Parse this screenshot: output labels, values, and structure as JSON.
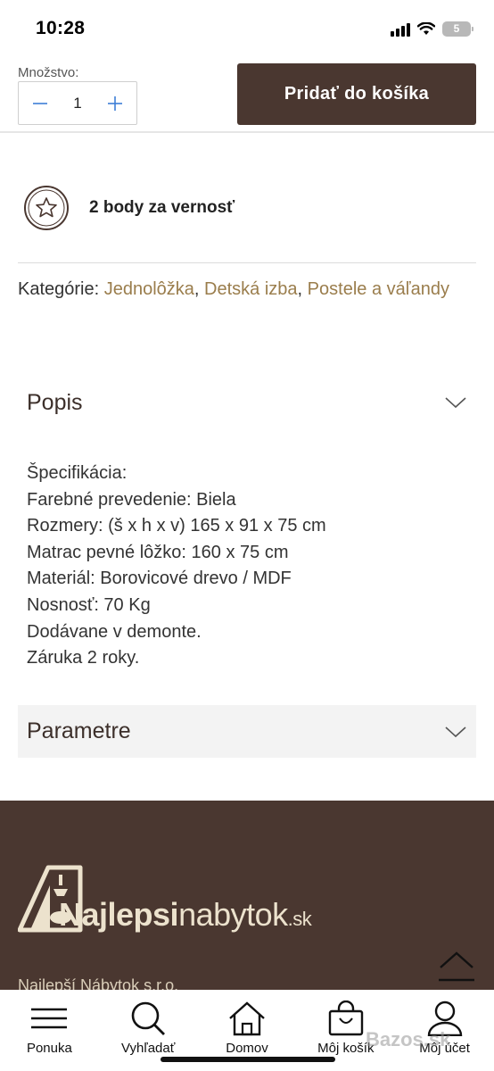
{
  "status_bar": {
    "time": "10:28",
    "battery": "5"
  },
  "cart_bar": {
    "quantity_label": "Množstvo:",
    "quantity_value": "1",
    "add_to_cart_label": "Pridať do košíka"
  },
  "loyalty": {
    "text": "2 body za vernosť"
  },
  "categories": {
    "label": "Kategórie:",
    "items": [
      "Jednolôžka",
      "Detská izba",
      "Postele a váľandy"
    ]
  },
  "description": {
    "title": "Popis",
    "lines": [
      "Špecifikácia:",
      "Farebné prevedenie: Biela",
      "Rozmery: (š x h x v) 165 x 91 x 75 cm",
      "Matrac pevné lôžko: 160 x 75 cm",
      "Materiál: Borovicové drevo / MDF",
      "Nosnosť: 70 Kg",
      "Dodávane v demonte.",
      "Záruka 2 roky."
    ]
  },
  "parameters": {
    "title": "Parametre"
  },
  "footer": {
    "logo": {
      "part1": "Najlepsi",
      "part2": "nabytok",
      "part3": ".sk"
    },
    "company": "Najlepší Nábytok s.r.o."
  },
  "bottom_nav": [
    {
      "label": "Ponuka",
      "icon": "menu-icon"
    },
    {
      "label": "Vyhľadať",
      "icon": "search-icon"
    },
    {
      "label": "Domov",
      "icon": "home-icon"
    },
    {
      "label": "Môj košík",
      "icon": "shopping-bag-icon"
    },
    {
      "label": "Môj účet",
      "icon": "user-icon"
    }
  ],
  "watermark": "Bazos.sk",
  "colors": {
    "brand": "#4a3730",
    "link": "#9a7d4c",
    "logo": "#ece2cd"
  }
}
